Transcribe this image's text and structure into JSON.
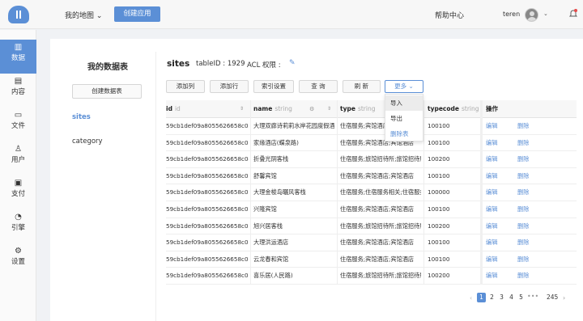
{
  "header": {
    "map_label": "我的地图",
    "create_app_label": "创建应用",
    "help_label": "帮助中心",
    "user_name": "teren"
  },
  "sidebar": {
    "items": [
      {
        "label": "数据",
        "icon": "bar-chart-icon"
      },
      {
        "label": "内容",
        "icon": "document-icon"
      },
      {
        "label": "文件",
        "icon": "folder-icon"
      },
      {
        "label": "用户",
        "icon": "user-icon"
      },
      {
        "label": "支付",
        "icon": "card-icon"
      },
      {
        "label": "引擎",
        "icon": "gauge-icon"
      },
      {
        "label": "设置",
        "icon": "gear-icon"
      }
    ]
  },
  "tables_panel": {
    "title": "我的数据表",
    "create_label": "创建数据表",
    "tables": [
      "sites",
      "category"
    ]
  },
  "table_header": {
    "name": "sites",
    "table_id": "tableID : 1929",
    "acl": "ACL 权限 :"
  },
  "toolbar": {
    "add_column": "添加列",
    "add_row": "添加行",
    "index": "索引设置",
    "query": "查 询",
    "refresh": "刷 新",
    "more": "更多"
  },
  "more_menu": [
    "导入",
    "导出",
    "删除表"
  ],
  "columns": [
    {
      "name": "id",
      "type": "id"
    },
    {
      "name": "name",
      "type": "string"
    },
    {
      "name": "type",
      "type": "string"
    },
    {
      "name": "typecode",
      "type": "string"
    },
    {
      "name": "操作",
      "type": ""
    }
  ],
  "rows": [
    {
      "id": "59cb1def09a8055626658c02",
      "name": "大理双廊诗莉莉水岸花园度假酒店",
      "type": "住宿服务;宾馆酒店;宾馆酒店",
      "typecode": "100100"
    },
    {
      "id": "59cb1def09a8055626658c03",
      "name": "家缘酒店(蝶泉路)",
      "type": "住宿服务;宾馆酒店;宾馆酒店",
      "typecode": "100100"
    },
    {
      "id": "59cb1def09a8055626658c04",
      "name": "折叠光阴客栈",
      "type": "住宿服务;旅馆招待所;旅馆招待所",
      "typecode": "100200"
    },
    {
      "id": "59cb1def09a8055626658c05",
      "name": "舒馨宾馆",
      "type": "住宿服务;宾馆酒店;宾馆酒店",
      "typecode": "100100"
    },
    {
      "id": "59cb1def09a8055626658c06",
      "name": "大理金梭岛曬风客栈",
      "type": "住宿服务;住宿服务相关;住宿服务相关",
      "typecode": "100000"
    },
    {
      "id": "59cb1def09a8055626658c07",
      "name": "兴隆宾馆",
      "type": "住宿服务;宾馆酒店;宾馆酒店",
      "typecode": "100100"
    },
    {
      "id": "59cb1def09a8055626658c08",
      "name": "旭兴居客栈",
      "type": "住宿服务;旅馆招待所;旅馆招待所",
      "typecode": "100200"
    },
    {
      "id": "59cb1def09a8055626658c09",
      "name": "大理洪运酒店",
      "type": "住宿服务;宾馆酒店;宾馆酒店",
      "typecode": "100100"
    },
    {
      "id": "59cb1def09a8055626658c0a",
      "name": "云龙春和宾馆",
      "type": "住宿服务;宾馆酒店;宾馆酒店",
      "typecode": "100100"
    },
    {
      "id": "59cb1def09a8055626658c0b",
      "name": "喜乐居(人民路)",
      "type": "住宿服务;旅馆招待所;旅馆招待所",
      "typecode": "100200"
    }
  ],
  "row_actions": {
    "edit": "编辑",
    "delete": "删除"
  },
  "pagination": {
    "pages": [
      "1",
      "2",
      "3",
      "4",
      "5"
    ],
    "current": "1",
    "ellipsis": "•••",
    "last": "245"
  },
  "colors": {
    "accent": "#5b8fd6",
    "danger": "#e64b4b"
  }
}
